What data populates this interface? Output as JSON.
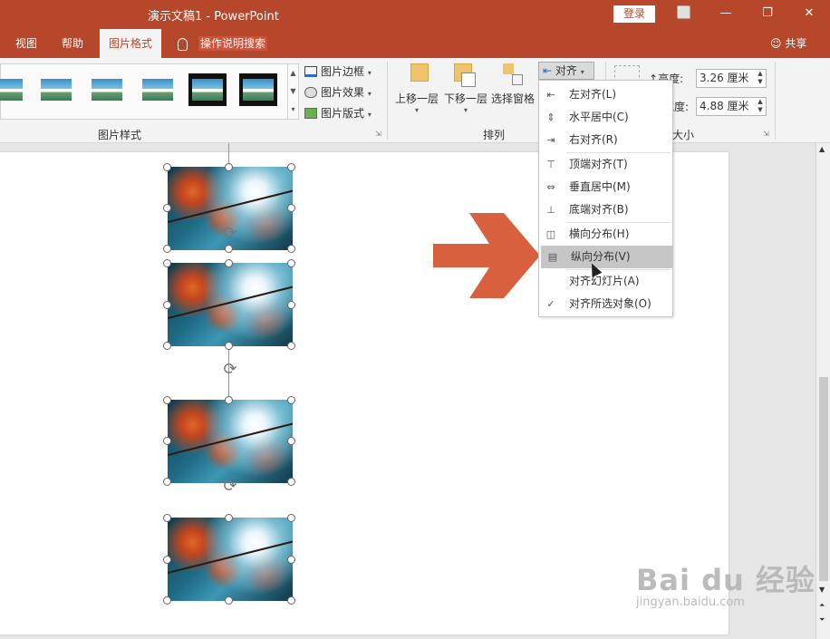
{
  "window": {
    "title": "演示文稿1  -  PowerPoint",
    "login": "登录",
    "controls": [
      "⬜",
      "—",
      "❐",
      "✕"
    ]
  },
  "tabs": [
    {
      "label": "视图"
    },
    {
      "label": "帮助"
    },
    {
      "label": "图片格式",
      "active": true
    }
  ],
  "tell_me": "操作说明搜索",
  "share": "共享",
  "ribbon": {
    "picture_styles_group": "图片样式",
    "picture_border": "图片边框",
    "picture_effects": "图片效果",
    "picture_layout": "图片版式",
    "arrange_group": "排列",
    "bring_forward": "上移一层",
    "send_backward": "下移一层",
    "selection_pane": "选择窗格",
    "align": "对齐",
    "size_group": "大小",
    "height_label": "高度:",
    "height_value": "3.26 厘米",
    "width_label": "宽度:",
    "width_value": "4.88 厘米"
  },
  "align_menu": [
    {
      "label": "左对齐(L)",
      "icon": "align-left-icon"
    },
    {
      "label": "水平居中(C)",
      "icon": "align-center-icon"
    },
    {
      "label": "右对齐(R)",
      "icon": "align-right-icon"
    },
    {
      "label": "顶端对齐(T)",
      "icon": "align-top-icon"
    },
    {
      "label": "垂直居中(M)",
      "icon": "align-middle-icon"
    },
    {
      "label": "底端对齐(B)",
      "icon": "align-bottom-icon"
    },
    {
      "label": "横向分布(H)",
      "icon": "distribute-horizontal-icon"
    },
    {
      "label": "纵向分布(V)",
      "icon": "distribute-vertical-icon",
      "highlighted": true
    },
    {
      "label": "对齐幻灯片(A)",
      "icon": ""
    },
    {
      "label": "对齐所选对象(O)",
      "icon": "check-icon",
      "checked": true
    }
  ],
  "colors": {
    "accent": "#b7472a",
    "arrow": "#d8603e"
  },
  "watermark": {
    "brand": "Bai du 经验",
    "url": "jingyan.baidu.com"
  }
}
